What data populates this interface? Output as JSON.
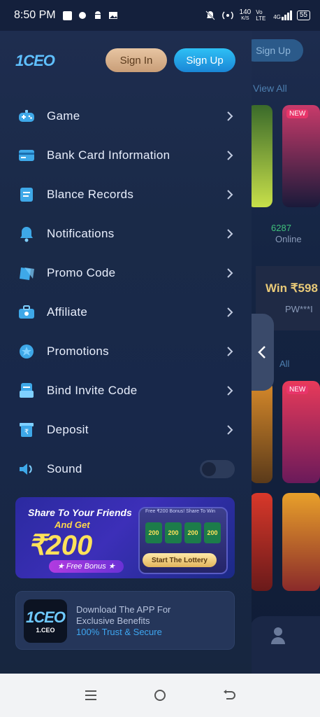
{
  "status_bar": {
    "time": "8:50 PM",
    "speed": "140",
    "speed_unit": "K/S",
    "network": "Vo LTE",
    "signal": "4G",
    "battery": "55"
  },
  "background": {
    "signup_label": "Sign Up",
    "view_all": "View All",
    "online_count": "6287",
    "online_label": "Online",
    "win_text": "Win ₹598",
    "win_user": "PW***I",
    "all_label": "All",
    "new_badge": "NEW"
  },
  "drawer": {
    "logo": "1CEO",
    "signin_label": "Sign In",
    "signup_label": "Sign Up",
    "menu": [
      {
        "label": "Game",
        "icon": "gamepad-icon"
      },
      {
        "label": "Bank Card Information",
        "icon": "bank-card-icon"
      },
      {
        "label": "Blance Records",
        "icon": "records-icon"
      },
      {
        "label": "Notifications",
        "icon": "bell-icon"
      },
      {
        "label": "Promo Code",
        "icon": "ticket-icon"
      },
      {
        "label": "Affiliate",
        "icon": "briefcase-icon"
      },
      {
        "label": "Promotions",
        "icon": "gift-icon"
      },
      {
        "label": "Bind Invite Code",
        "icon": "invite-icon"
      },
      {
        "label": "Deposit",
        "icon": "deposit-icon"
      },
      {
        "label": "Sound",
        "icon": "speaker-icon",
        "toggle": false
      }
    ],
    "banner": {
      "title": "Share To Your Friends",
      "subtitle": "And Get",
      "amount": "₹200",
      "bonus": "★ Free Bonus ★",
      "machine_top": "Free ₹200 Bonus! Share To Win",
      "reels": [
        "200",
        "200",
        "200",
        "200"
      ],
      "cta": "Start The Lottery"
    },
    "app_card": {
      "logo_main": "1CEO",
      "logo_sub": "1.CEO",
      "line1": "Download The APP For",
      "line2": "Exclusive Benefits",
      "line3": "100% Trust & Secure"
    }
  },
  "colors": {
    "accent_blue": "#1a86d6",
    "signin_gold": "#c99e78",
    "drawer_bg": "#1e2d4f"
  }
}
